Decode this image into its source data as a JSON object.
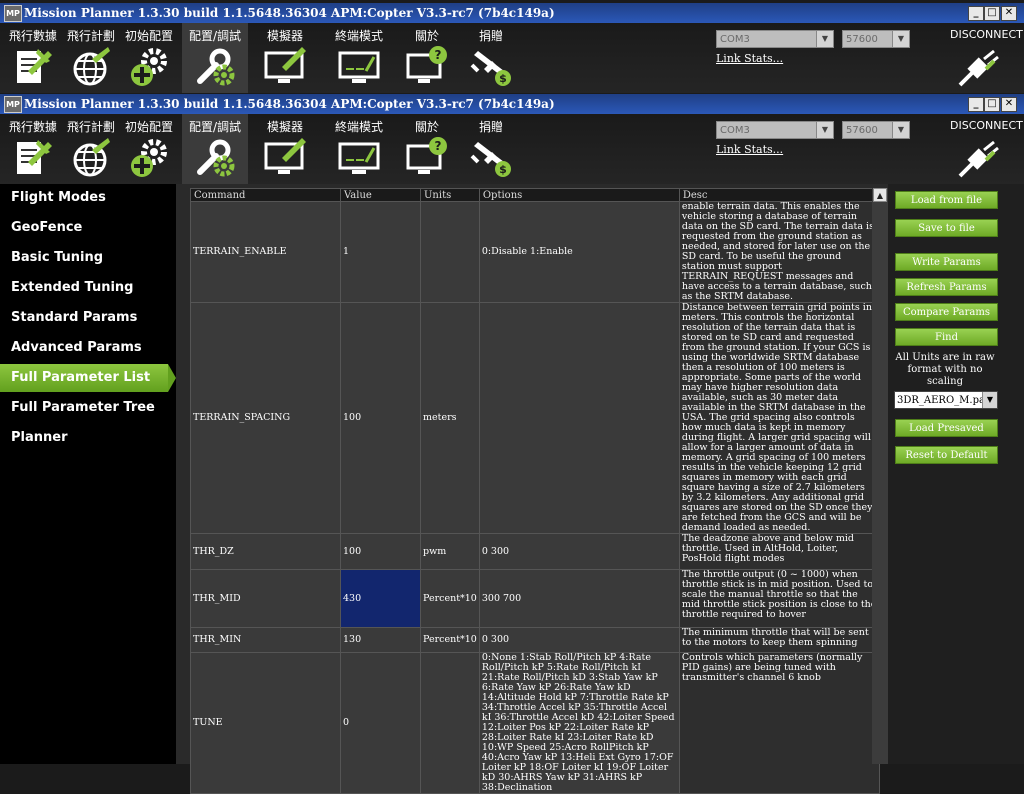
{
  "window_title": "Mission Planner 1.3.30 build 1.1.5648.36304 APM:Copter V3.3-rc7 (7b4c149a)",
  "app_icon_text": "MP",
  "toolbar": {
    "items": [
      {
        "label": "飛行數據",
        "icon": "flight-data-icon"
      },
      {
        "label": "飛行計劃",
        "icon": "globe-icon"
      },
      {
        "label": "初始配置",
        "icon": "gears-plus-icon"
      },
      {
        "label": "配置/調試",
        "icon": "wrench-gear-icon"
      },
      {
        "label": "模擬器",
        "icon": "simulator-monitor-icon"
      },
      {
        "label": "終端模式",
        "icon": "terminal-monitor-icon"
      },
      {
        "label": "關於",
        "icon": "help-monitor-icon"
      },
      {
        "label": "捐贈",
        "icon": "donate-plane-icon"
      }
    ],
    "com_port": "COM3",
    "baud": "57600",
    "link_stats": "Link Stats...",
    "disconnect": "DISCONNECT"
  },
  "sidebar": {
    "items": [
      {
        "label": "Flight Modes"
      },
      {
        "label": "GeoFence"
      },
      {
        "label": "Basic Tuning"
      },
      {
        "label": "Extended Tuning"
      },
      {
        "label": "Standard Params"
      },
      {
        "label": "Advanced Params"
      },
      {
        "label": "Full Parameter List"
      },
      {
        "label": "Full Parameter Tree"
      },
      {
        "label": "Planner"
      }
    ],
    "active": "Full Parameter List"
  },
  "grid": {
    "headers": [
      "Command",
      "Value",
      "Units",
      "Options",
      "Desc"
    ],
    "rows": [
      {
        "command": "TERRAIN_ENABLE",
        "value": "1",
        "units": "",
        "options": "0:Disable 1:Enable",
        "desc": "enable terrain data. This enables the vehicle storing a database of terrain data on the SD card. The terrain data is requested from the ground station as needed, and stored for later use on the SD card. To be useful the ground station must support TERRAIN_REQUEST messages and have access to a terrain database, such as the SRTM database."
      },
      {
        "command": "TERRAIN_SPACING",
        "value": "100",
        "units": "meters",
        "options": "",
        "desc": "Distance between terrain grid points in meters. This controls the horizontal resolution of the terrain data that is stored on te SD card and requested from the ground station. If your GCS is using the worldwide SRTM database then a resolution of 100 meters is appropriate. Some parts of the world may have higher resolution data available, such as 30 meter data available in the SRTM database in the USA. The grid spacing also controls how much data is kept in memory during flight. A larger grid spacing will allow for a larger amount of data in memory. A grid spacing of 100 meters results in the vehicle keeping 12 grid squares in memory with each grid square having a size of 2.7 kilometers by 3.2 kilometers. Any additional grid squares are stored on the SD once they are fetched from the GCS and will be demand loaded as needed."
      },
      {
        "command": "THR_DZ",
        "value": "100",
        "units": "pwm",
        "options": "0 300",
        "desc": "The deadzone above and below mid throttle. Used in AltHold, Loiter, PosHold flight modes"
      },
      {
        "command": "THR_MID",
        "value": "430",
        "units": "Percent*10",
        "options": "300 700",
        "desc": "The throttle output (0 ~ 1000) when throttle stick is in mid position.  Used to scale the manual throttle so that the mid throttle stick position is close to the throttle required to hover"
      },
      {
        "command": "THR_MIN",
        "value": "130",
        "units": "Percent*10",
        "options": "0 300",
        "desc": "The minimum throttle that will be sent to the motors to keep them spinning"
      },
      {
        "command": "TUNE",
        "value": "0",
        "units": "",
        "options": "0:None 1:Stab Roll/Pitch kP 4:Rate Roll/Pitch kP 5:Rate Roll/Pitch kI 21:Rate Roll/Pitch kD 3:Stab Yaw kP 6:Rate Yaw kP 26:Rate Yaw kD 14:Altitude Hold kP 7:Throttle Rate kP 34:Throttle Accel kP 35:Throttle Accel kI 36:Throttle Accel kD 42:Loiter Speed 12:Loiter Pos kP 22:Loiter Rate kP 28:Loiter Rate kI 23:Loiter Rate kD 10:WP Speed 25:Acro RollPitch kP 40:Acro Yaw kP 13:Heli Ext Gyro 17:OF Loiter kP 18:OF Loiter kI 19:OF Loiter kD 30:AHRS Yaw kP 31:AHRS kP 38:Declination",
        "desc": "Controls which parameters (normally PID gains) are being tuned with transmitter's channel 6 knob"
      }
    ]
  },
  "right_panel": {
    "load_from_file": "Load from file",
    "save_to_file": "Save to file",
    "write_params": "Write Params",
    "refresh_params": "Refresh Params",
    "compare_params": "Compare Params",
    "find": "Find",
    "note": "All Units are in raw format with no scaling",
    "param_file": "3DR_AERO_M.param",
    "load_presaved": "Load Presaved",
    "reset_default": "Reset to Default"
  },
  "colors": {
    "accent_green": "#8dc63f",
    "title_blue": "#2b58b8",
    "selected_cell": "#12266e"
  }
}
